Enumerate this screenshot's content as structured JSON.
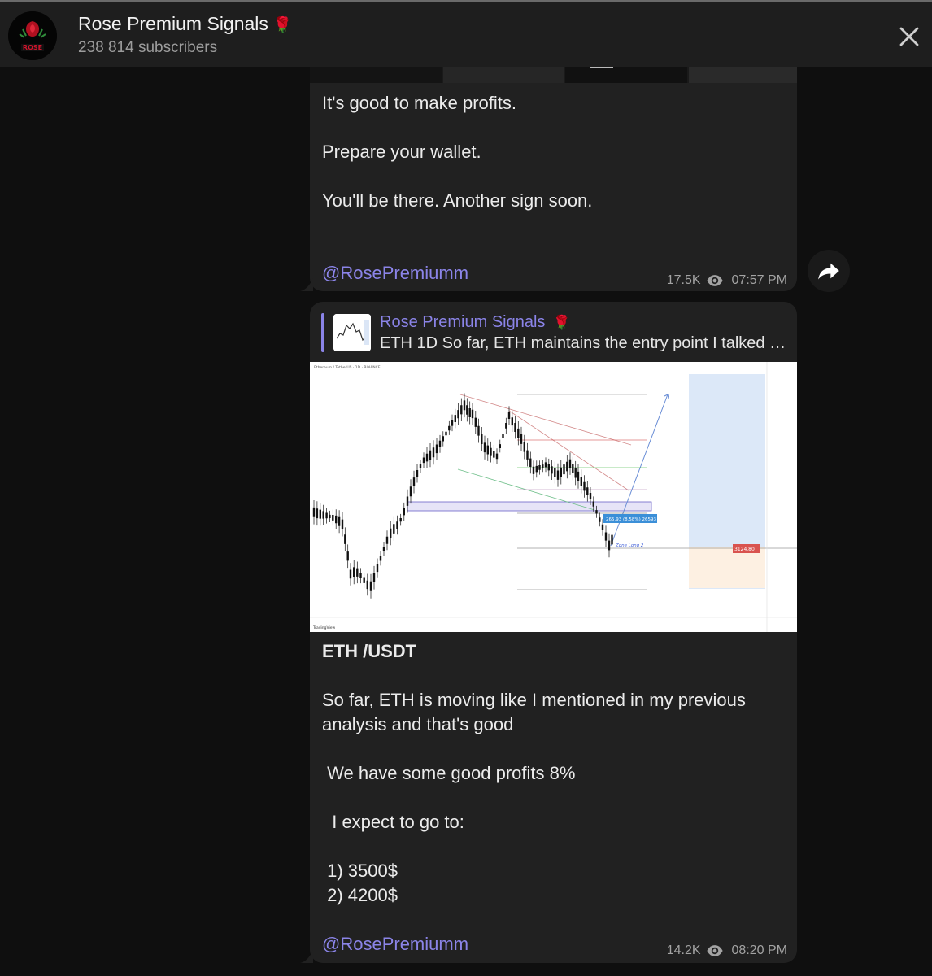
{
  "channel": {
    "name": "Rose Premium Signals",
    "emoji": "🌹",
    "subscribers": "238 814 subscribers",
    "avatar_text": "ROSE"
  },
  "icons": {
    "close": "close-icon",
    "forward": "forward-arrow-icon",
    "views": "eye-icon"
  },
  "messages": [
    {
      "lines": [
        "It's good to make profits.",
        "Prepare your wallet.",
        "You'll be there. Another sign soon."
      ],
      "signature": "@RosePremiumm",
      "views": "17.5K",
      "time": "07:57 PM"
    },
    {
      "reply": {
        "name": "Rose Premium Signals",
        "emoji": "🌹",
        "text": "ETH 1D So far, ETH maintains the entry point I talked a..."
      },
      "chart": {
        "header": "Ethereum / TetherUS · 1D · BINANCE",
        "box_label": "265.93 (8.58%) 26593",
        "zone_label": "Zone Long 2",
        "price_tag": "3124.80",
        "watermark": "TradingView"
      },
      "title": "ETH /USDT",
      "lines": [
        "So far, ETH is moving like I mentioned in my previous",
        "analysis and that's good",
        " We have some good profits 8%",
        "  I expect to go to:",
        " 1) 3500$",
        " 2) 4200$"
      ],
      "signature": "@RosePremiumm",
      "views": "14.2K",
      "time": "08:20 PM"
    }
  ],
  "colors": {
    "accent": "#8b84e8",
    "bubble": "#212121",
    "header": "#1e1e1e",
    "background": "#0f0f0f",
    "rose": "#d0142c"
  }
}
